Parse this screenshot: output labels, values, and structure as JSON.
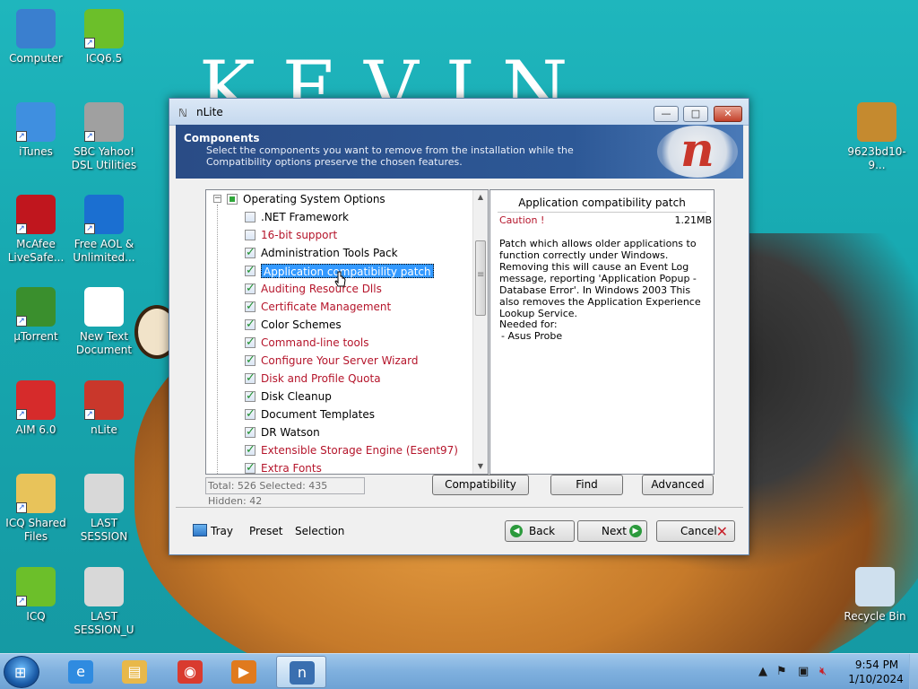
{
  "wallpaper": {
    "text": "KEVIN"
  },
  "desktop_icons": [
    {
      "label": "Computer",
      "icon": "computer-icon",
      "color": "#3a7fcf",
      "shortcut": false
    },
    {
      "label": "ICQ6.5",
      "icon": "icq-flower-icon",
      "color": "#6cbf2a",
      "shortcut": true
    },
    {
      "label": "iTunes",
      "icon": "itunes-icon",
      "color": "#3f8fe0",
      "shortcut": true
    },
    {
      "label": "SBC Yahoo! DSL Utilities",
      "icon": "sbc-yahoo-icon",
      "color": "#a0a0a0",
      "shortcut": true
    },
    {
      "label": "McAfee LiveSafe...",
      "icon": "mcafee-shield-icon",
      "color": "#c0161e",
      "shortcut": true
    },
    {
      "label": "Free AOL & Unlimited...",
      "icon": "aol-icon",
      "color": "#1b6fd1",
      "shortcut": true
    },
    {
      "label": "µTorrent",
      "icon": "utorrent-icon",
      "color": "#3a8f2d",
      "shortcut": true
    },
    {
      "label": "New Text Document",
      "icon": "text-document-icon",
      "color": "#ffffff",
      "shortcut": false
    },
    {
      "label": "AIM 6.0",
      "icon": "aim-icon",
      "color": "#d62b2b",
      "shortcut": true
    },
    {
      "label": "nLite",
      "icon": "nlite-icon",
      "color": "#c9372b",
      "shortcut": true
    },
    {
      "label": "ICQ Shared Files",
      "icon": "icq-folder-icon",
      "color": "#e8c35a",
      "shortcut": true
    },
    {
      "label": "LAST SESSION",
      "icon": "settings-file-icon",
      "color": "#d8d8d8",
      "shortcut": false
    },
    {
      "label": "ICQ",
      "icon": "icq-flower-icon",
      "color": "#6cbf2a",
      "shortcut": true
    },
    {
      "label": "LAST SESSION_U",
      "icon": "settings-file-icon",
      "color": "#d8d8d8",
      "shortcut": false
    },
    {
      "label": "9623bd10-9...",
      "icon": "image-file-icon",
      "color": "#c58a2f",
      "shortcut": false
    },
    {
      "label": "Recycle Bin",
      "icon": "recycle-bin-icon",
      "color": "#cfe0ee",
      "shortcut": false
    }
  ],
  "window": {
    "title": "nLite",
    "min_label": "—",
    "max_label": "□",
    "close_label": "✕",
    "header": {
      "title": "Components",
      "description": "Select the components you want to remove from the installation while the Compatibility options preserve the chosen features."
    },
    "tree": {
      "root_label": "Operating System Options",
      "items": [
        {
          "label": ".NET Framework",
          "checked": false,
          "red": false,
          "selected": false
        },
        {
          "label": "16-bit support",
          "checked": false,
          "red": true,
          "selected": false
        },
        {
          "label": "Administration Tools Pack",
          "checked": true,
          "red": false,
          "selected": false
        },
        {
          "label": "Application compatibility patch",
          "checked": true,
          "red": false,
          "selected": true
        },
        {
          "label": "Auditing Resource Dlls",
          "checked": true,
          "red": true,
          "selected": false
        },
        {
          "label": "Certificate Management",
          "checked": true,
          "red": true,
          "selected": false
        },
        {
          "label": "Color Schemes",
          "checked": true,
          "red": false,
          "selected": false
        },
        {
          "label": "Command-line tools",
          "checked": true,
          "red": true,
          "selected": false
        },
        {
          "label": "Configure Your Server Wizard",
          "checked": true,
          "red": true,
          "selected": false
        },
        {
          "label": "Disk and Profile Quota",
          "checked": true,
          "red": true,
          "selected": false
        },
        {
          "label": "Disk Cleanup",
          "checked": true,
          "red": false,
          "selected": false
        },
        {
          "label": "Document Templates",
          "checked": true,
          "red": false,
          "selected": false
        },
        {
          "label": "DR Watson",
          "checked": true,
          "red": false,
          "selected": false
        },
        {
          "label": "Extensible Storage Engine (Esent97)",
          "checked": true,
          "red": true,
          "selected": false
        },
        {
          "label": "Extra Fonts",
          "checked": true,
          "red": true,
          "selected": false
        }
      ]
    },
    "info": {
      "title": "Application compatibility patch",
      "caution": "Caution !",
      "size": "1.21MB",
      "description": "Patch which allows older applications to function correctly under Windows. Removing this will cause an Event Log message, reporting 'Application Popup - Database Error'. In Windows 2003 This also removes the Application Experience Lookup Service.",
      "needed_label": "Needed for:",
      "needed_item": "- Asus Probe"
    },
    "stats": "Total: 526 Selected: 435 Hidden: 42",
    "buttons": {
      "compatibility": "Compatibility",
      "find": "Find",
      "advanced": "Advanced",
      "back": "Back",
      "next": "Next",
      "cancel": "Cancel"
    },
    "bottom_links": {
      "tray": "Tray",
      "preset": "Preset",
      "selection": "Selection"
    }
  },
  "taskbar": {
    "apps": [
      {
        "icon": "internet-explorer-icon",
        "color": "#2f8be0",
        "glyph": "e",
        "active": false
      },
      {
        "icon": "file-explorer-icon",
        "color": "#e8b84a",
        "glyph": "▤",
        "active": false
      },
      {
        "icon": "chrome-icon",
        "color": "#d93b2f",
        "glyph": "◉",
        "active": false
      },
      {
        "icon": "media-player-icon",
        "color": "#e07a1e",
        "glyph": "▶",
        "active": false
      },
      {
        "icon": "nlite-icon",
        "color": "#3a6fb0",
        "glyph": "n",
        "active": true
      }
    ],
    "clock": {
      "time": "9:54 PM",
      "date": "1/10/2024"
    }
  }
}
